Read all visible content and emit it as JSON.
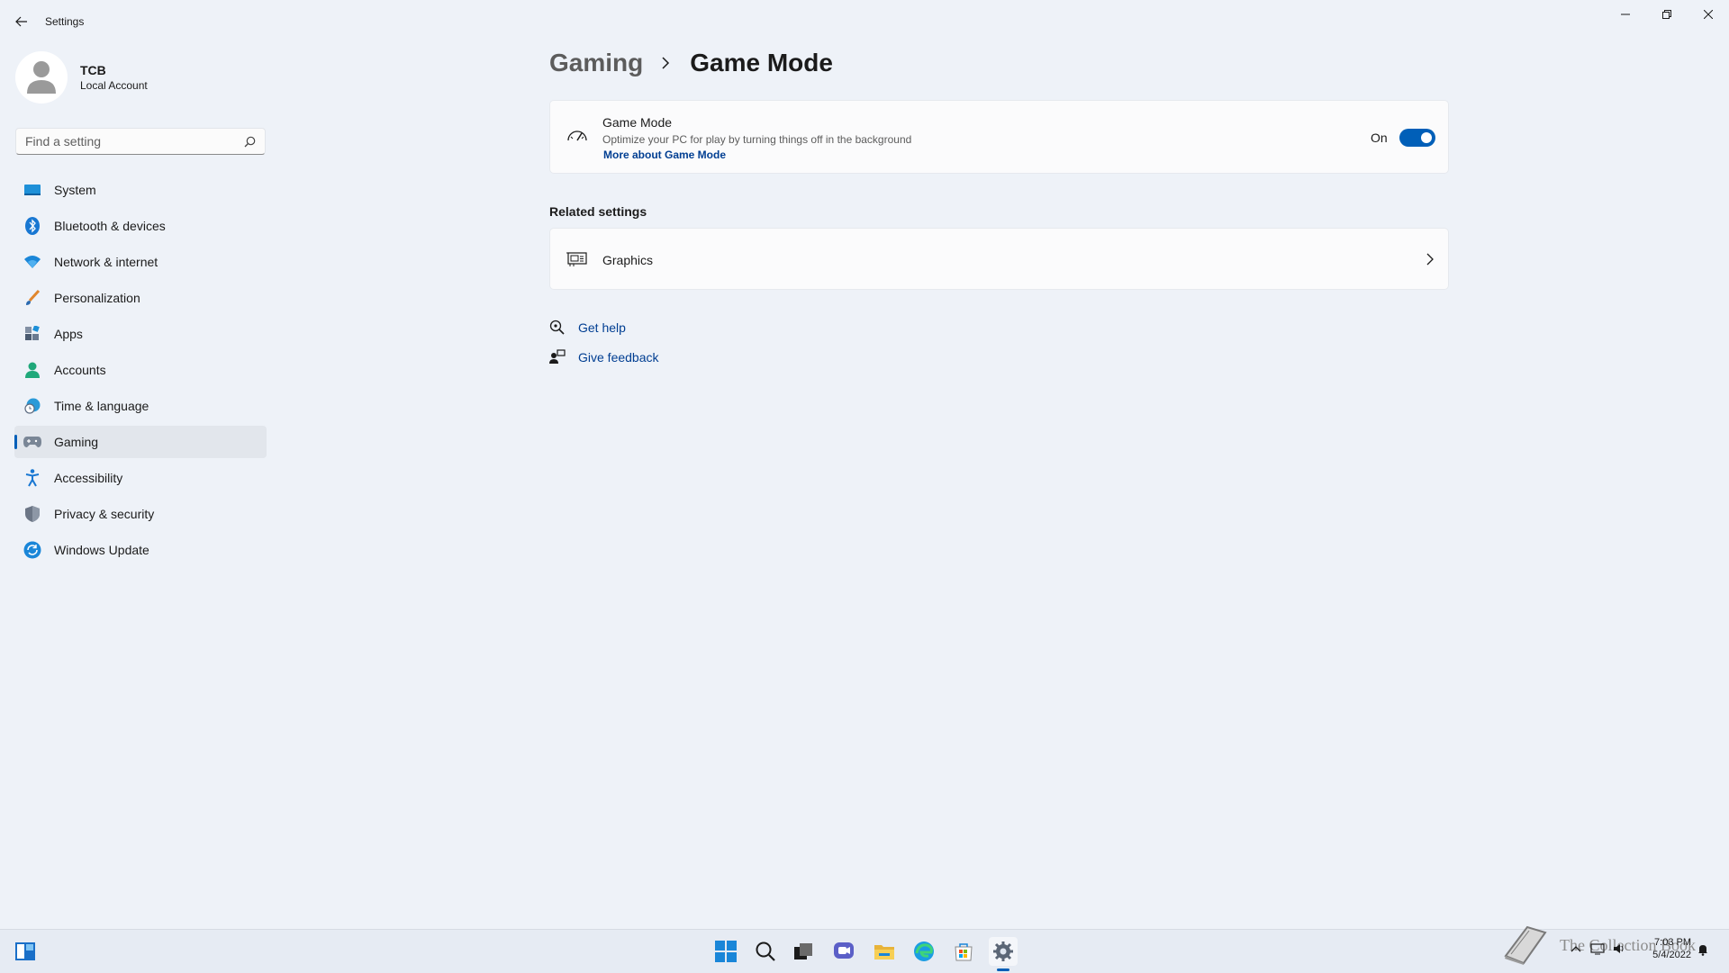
{
  "window": {
    "title": "Settings"
  },
  "profile": {
    "name": "TCB",
    "account_type": "Local Account"
  },
  "search": {
    "placeholder": "Find a setting"
  },
  "sidebar": {
    "items": [
      {
        "label": "System",
        "icon": "monitor-icon"
      },
      {
        "label": "Bluetooth & devices",
        "icon": "bluetooth-icon"
      },
      {
        "label": "Network & internet",
        "icon": "wifi-icon"
      },
      {
        "label": "Personalization",
        "icon": "brush-icon"
      },
      {
        "label": "Apps",
        "icon": "apps-icon"
      },
      {
        "label": "Accounts",
        "icon": "person-icon"
      },
      {
        "label": "Time & language",
        "icon": "globe-clock-icon"
      },
      {
        "label": "Gaming",
        "icon": "controller-icon",
        "selected": true
      },
      {
        "label": "Accessibility",
        "icon": "accessibility-icon"
      },
      {
        "label": "Privacy & security",
        "icon": "shield-icon"
      },
      {
        "label": "Windows Update",
        "icon": "update-icon"
      }
    ]
  },
  "breadcrumb": {
    "parent": "Gaming",
    "current": "Game Mode"
  },
  "game_mode": {
    "title": "Game Mode",
    "description": "Optimize your PC for play by turning things off in the background",
    "link": "More about Game Mode",
    "state_label": "On",
    "enabled": true
  },
  "related": {
    "title": "Related settings",
    "graphics_label": "Graphics"
  },
  "help": {
    "get_help": "Get help",
    "give_feedback": "Give feedback"
  },
  "taskbar": {
    "apps": [
      "widgets-icon",
      "start-icon",
      "search-icon",
      "task-view-icon",
      "chat-icon",
      "file-explorer-icon",
      "edge-icon",
      "store-icon",
      "settings-icon"
    ],
    "watermark": "The Collection Book",
    "time": "7:03 PM",
    "date": "5/4/2022"
  },
  "colors": {
    "accent": "#005fb8",
    "background": "#eef2f8",
    "link": "#003e92"
  }
}
